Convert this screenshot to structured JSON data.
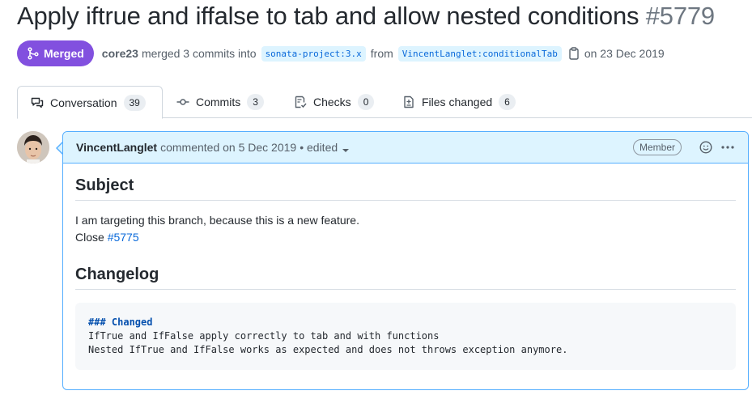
{
  "pr": {
    "title": "Apply iftrue and iffalse to tab and allow nested conditions",
    "number": "#5779",
    "state": "Merged",
    "author": "core23",
    "merge_text": "merged 3 commits into",
    "base_branch": "sonata-project:3.x",
    "from_text": "from",
    "head_branch": "VincentLanglet:conditionalTab",
    "date_text": "on 23 Dec 2019"
  },
  "tabs": [
    {
      "label": "Conversation",
      "count": "39",
      "icon": "comment-discussion-icon",
      "active": true
    },
    {
      "label": "Commits",
      "count": "3",
      "icon": "git-commit-icon",
      "active": false
    },
    {
      "label": "Checks",
      "count": "0",
      "icon": "checklist-icon",
      "active": false
    },
    {
      "label": "Files changed",
      "count": "6",
      "icon": "file-diff-icon",
      "active": false
    }
  ],
  "comment": {
    "author": "VincentLanglet",
    "action_text": "commented on 5 Dec 2019",
    "edited_text": "• edited",
    "role": "Member",
    "body": {
      "heading1": "Subject",
      "paragraph_line1": "I am targeting this branch, because this is a new feature.",
      "close_text": "Close",
      "close_issue": "#5775",
      "heading2": "Changelog",
      "code_heading": "### Changed",
      "code_line1": "IfTrue and IfFalse apply correctly to tab and with functions",
      "code_line2": "Nested IfTrue and IfFalse works as expected and does not throws exception anymore."
    }
  },
  "colors": {
    "merged": "#8250df",
    "link": "#0969da",
    "comment_header_bg": "#ddf4ff",
    "comment_border": "#54aeff"
  }
}
